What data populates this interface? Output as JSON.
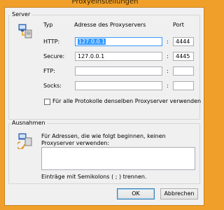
{
  "window": {
    "title": "Proxyeinstellungen"
  },
  "server": {
    "legend": "Server",
    "col_type": "Typ",
    "col_address": "Adresse des Proxyservers",
    "col_port": "Port",
    "rows": [
      {
        "label": "HTTP:",
        "address": "127.0.0.1",
        "port": "4444"
      },
      {
        "label": "Secure:",
        "address": "127.0.0.1",
        "port": "4445"
      },
      {
        "label": "FTP:",
        "address": "",
        "port": ""
      },
      {
        "label": "Socks:",
        "address": "",
        "port": ""
      }
    ],
    "colon": ":",
    "same_proxy_label": "Für alle Protokolle denselben Proxyserver verwenden",
    "same_proxy_checked": false
  },
  "exceptions": {
    "legend": "Ausnahmen",
    "description": "Für Adressen, die wie folgt beginnen, keinen Proxyserver verwenden:",
    "value": "",
    "hint": "Einträge mit Semikolons ( ; ) trennen."
  },
  "buttons": {
    "ok": "OK",
    "cancel": "Abbrechen"
  },
  "icons": {
    "server": "network-server-icon",
    "exceptions": "network-exceptions-icon"
  }
}
